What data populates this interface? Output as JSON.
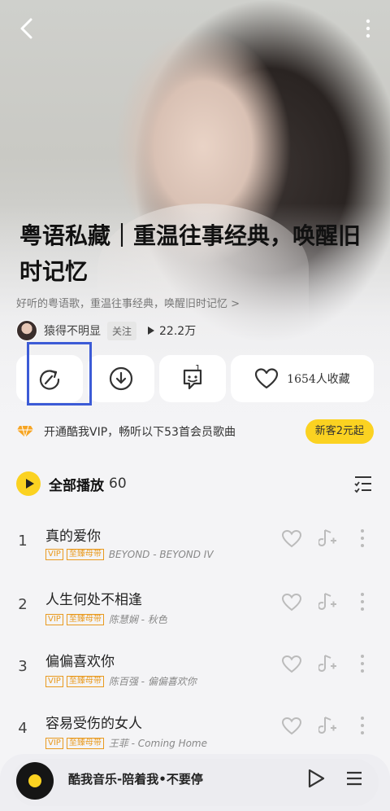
{
  "playlist": {
    "title": "粤语私藏｜重温往事经典，唤醒旧时记忆",
    "description": "好听的粤语歌，重温往事经典，唤醒旧时记忆 >",
    "author": "猿得不明显",
    "follow_label": "关注",
    "play_count": "22.2万"
  },
  "actions": {
    "comment_count": "1",
    "collect_label": "1654人收藏"
  },
  "vip_banner": {
    "text": "开通酷我VIP，畅听以下53首会员歌曲",
    "button_label": "新客2元起"
  },
  "play_all": {
    "label": "全部播放",
    "count": "60"
  },
  "songs": [
    {
      "num": "1",
      "title": "真的爱你",
      "vip": "VIP",
      "quality": "至臻母带",
      "artist": "BEYOND - BEYOND IV"
    },
    {
      "num": "2",
      "title": "人生何处不相逢",
      "vip": "VIP",
      "quality": "至臻母带",
      "artist": "陈慧娴 - 秋色"
    },
    {
      "num": "3",
      "title": "偏偏喜欢你",
      "vip": "VIP",
      "quality": "至臻母带",
      "artist": "陈百强 - 偏偏喜欢你"
    },
    {
      "num": "4",
      "title": "容易受伤的女人",
      "vip": "VIP",
      "quality": "至臻母带",
      "artist": "王菲 - Coming Home"
    }
  ],
  "player": {
    "now_playing": "酷我音乐-陪着我•不要停"
  },
  "colors": {
    "accent_yellow": "#fbd221",
    "vip_tag": "#e99a1f",
    "highlight": "#3c5bd6"
  }
}
